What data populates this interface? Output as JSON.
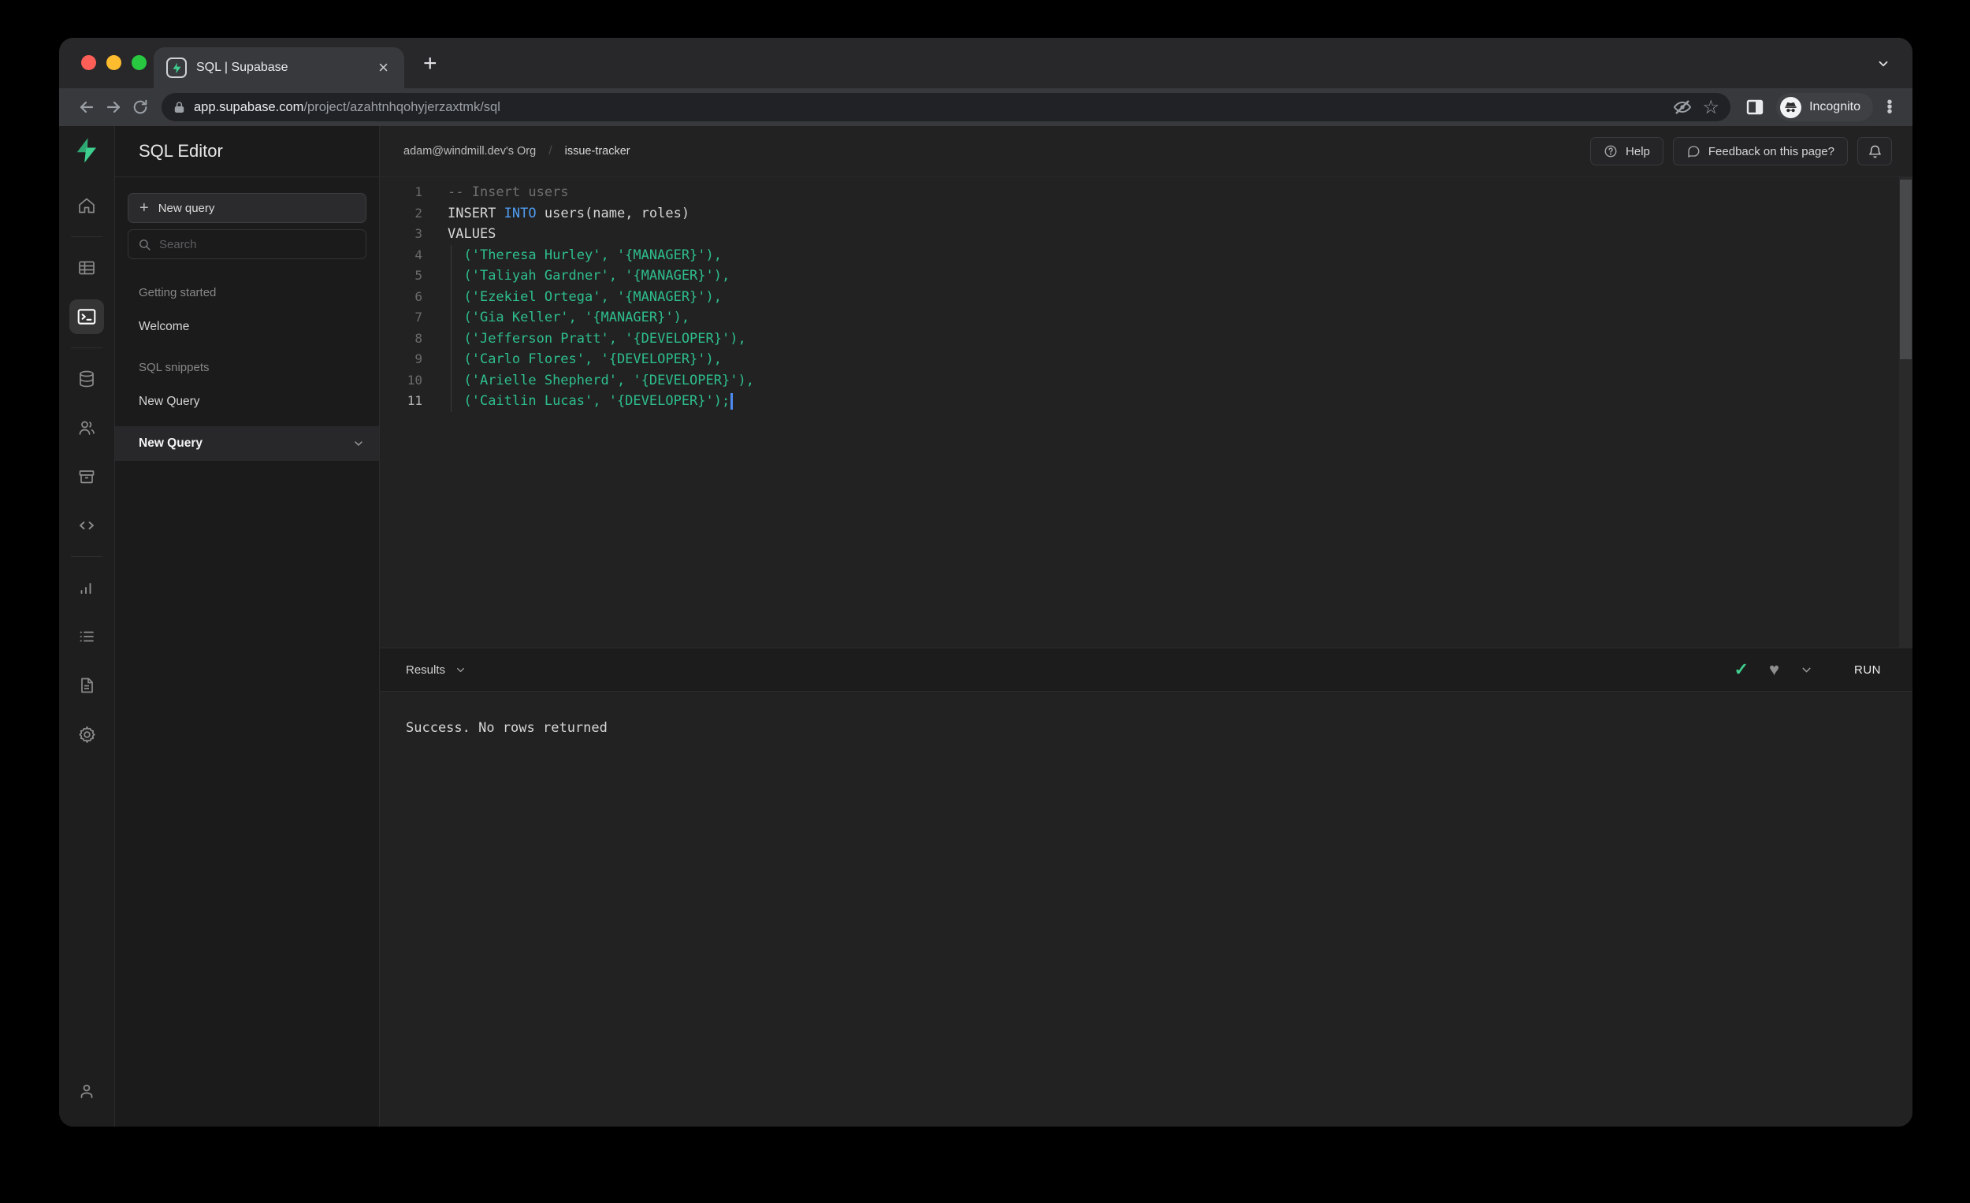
{
  "browser": {
    "tab": {
      "title": "SQL | Supabase"
    },
    "url": {
      "host": "app.supabase.com",
      "path": "/project/azahtnhqohyjerzaxtmk/sql"
    },
    "incognito_label": "Incognito"
  },
  "colors": {
    "accent_green": "#3ecf8e",
    "code_string": "#2ebe8e",
    "code_keyword": "#4f9cf0",
    "cursor_blue": "#4e8bf0"
  },
  "rail_icons": [
    "supabase-logo",
    "home",
    "table-editor",
    "sql-editor",
    "database",
    "auth-users",
    "storage",
    "edge-functions",
    "reports",
    "logs",
    "api-docs",
    "settings",
    "account"
  ],
  "sidebar": {
    "title": "SQL Editor",
    "new_query_button": "New query",
    "search_placeholder": "Search",
    "sections": [
      {
        "label": "Getting started",
        "items": [
          {
            "label": "Welcome"
          }
        ]
      },
      {
        "label": "SQL snippets",
        "items": [
          {
            "label": "New Query"
          },
          {
            "label": "New Query",
            "selected": true
          }
        ]
      }
    ]
  },
  "header": {
    "breadcrumb": {
      "org": "adam@windmill.dev's Org",
      "separator": "/",
      "project": "issue-tracker"
    },
    "help_button": "Help",
    "feedback_button": "Feedback on this page?"
  },
  "editor": {
    "lines": [
      {
        "num": "1",
        "segments": [
          {
            "type": "comment",
            "text": "-- Insert users"
          }
        ]
      },
      {
        "num": "2",
        "segments": [
          {
            "type": "plain",
            "text": "INSERT "
          },
          {
            "type": "keyword",
            "text": "INTO"
          },
          {
            "type": "plain",
            "text": " users(name, roles)"
          }
        ]
      },
      {
        "num": "3",
        "segments": [
          {
            "type": "plain",
            "text": "VALUES"
          }
        ]
      },
      {
        "num": "4",
        "segments": [
          {
            "type": "plain",
            "text": "  "
          },
          {
            "type": "string",
            "text": "('Theresa Hurley', '{MANAGER}'),"
          }
        ]
      },
      {
        "num": "5",
        "segments": [
          {
            "type": "plain",
            "text": "  "
          },
          {
            "type": "string",
            "text": "('Taliyah Gardner', '{MANAGER}'),"
          }
        ]
      },
      {
        "num": "6",
        "segments": [
          {
            "type": "plain",
            "text": "  "
          },
          {
            "type": "string",
            "text": "('Ezekiel Ortega', '{MANAGER}'),"
          }
        ]
      },
      {
        "num": "7",
        "segments": [
          {
            "type": "plain",
            "text": "  "
          },
          {
            "type": "string",
            "text": "('Gia Keller', '{MANAGER}'),"
          }
        ]
      },
      {
        "num": "8",
        "segments": [
          {
            "type": "plain",
            "text": "  "
          },
          {
            "type": "string",
            "text": "('Jefferson Pratt', '{DEVELOPER}'),"
          }
        ]
      },
      {
        "num": "9",
        "segments": [
          {
            "type": "plain",
            "text": "  "
          },
          {
            "type": "string",
            "text": "('Carlo Flores', '{DEVELOPER}'),"
          }
        ]
      },
      {
        "num": "10",
        "segments": [
          {
            "type": "plain",
            "text": "  "
          },
          {
            "type": "string",
            "text": "('Arielle Shepherd', '{DEVELOPER}'),"
          }
        ]
      },
      {
        "num": "11",
        "active": true,
        "cursor": true,
        "segments": [
          {
            "type": "plain",
            "text": "  "
          },
          {
            "type": "string",
            "text": "('Caitlin Lucas', '{DEVELOPER}');"
          }
        ]
      }
    ]
  },
  "results": {
    "label": "Results",
    "run_button": "RUN",
    "status_message": "Success. No rows returned"
  }
}
